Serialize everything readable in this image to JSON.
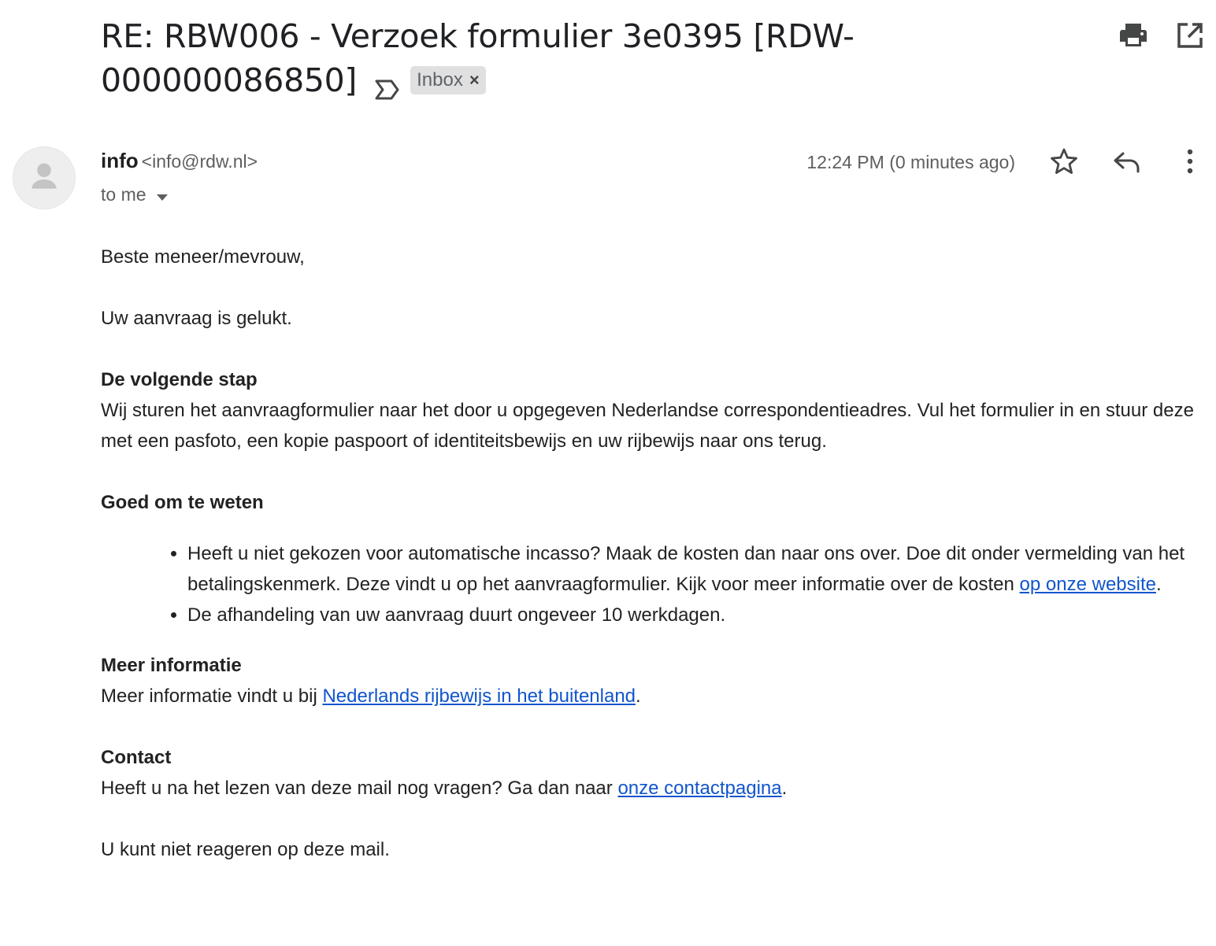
{
  "subject": {
    "title": "RE: RBW006 - Verzoek formulier 3e0395 [RDW-000000086850]",
    "label": "Inbox",
    "label_remove": "×"
  },
  "toolbar": {
    "print_icon": "print-icon",
    "popout_icon": "open-in-new-window-icon"
  },
  "message": {
    "sender_name": "info",
    "sender_email": "<info@rdw.nl>",
    "recipient": "to me",
    "timestamp": "12:24 PM (0 minutes ago)",
    "icons": [
      "star-icon",
      "reply-icon",
      "more-vert-icon"
    ]
  },
  "body": {
    "greeting": "Beste meneer/mevrouw,",
    "intro": "Uw aanvraag is gelukt.",
    "next_step_heading": "De volgende stap",
    "next_step_text": "Wij sturen het aanvraagformulier naar het door u opgegeven Nederlandse correspondentieadres. Vul het formulier in en stuur deze met een pasfoto, een kopie paspoort of identiteitsbewijs en uw rijbewijs naar ons terug.",
    "good_to_know_heading": "Goed om te weten",
    "bullet1_text": "Heeft u niet gekozen voor automatische incasso? Maak de kosten dan naar ons over. Doe dit onder vermelding van het betalingskenmerk. Deze vindt u op het aanvraagformulier. Kijk voor meer informatie over de kosten ",
    "bullet1_link": "op onze website",
    "bullet1_end": ".",
    "bullet2_text": "De afhandeling van uw aanvraag duurt ongeveer 10 werkdagen.",
    "more_info_heading": "Meer informatie",
    "more_info_text": "Meer informatie vindt u bij ",
    "more_info_link": "Nederlands rijbewijs in het buitenland",
    "more_info_end": ".",
    "contact_heading": "Contact",
    "contact_text": "Heeft u na het lezen van deze mail nog vragen? Ga dan naar ",
    "contact_link": "onze contactpagina",
    "contact_end": ".",
    "closing": "U kunt niet reageren op deze mail."
  },
  "colors": {
    "link": "#1155cc",
    "chip_bg": "#e0e0e0",
    "text": "#222222",
    "muted": "#5e5e5e"
  }
}
